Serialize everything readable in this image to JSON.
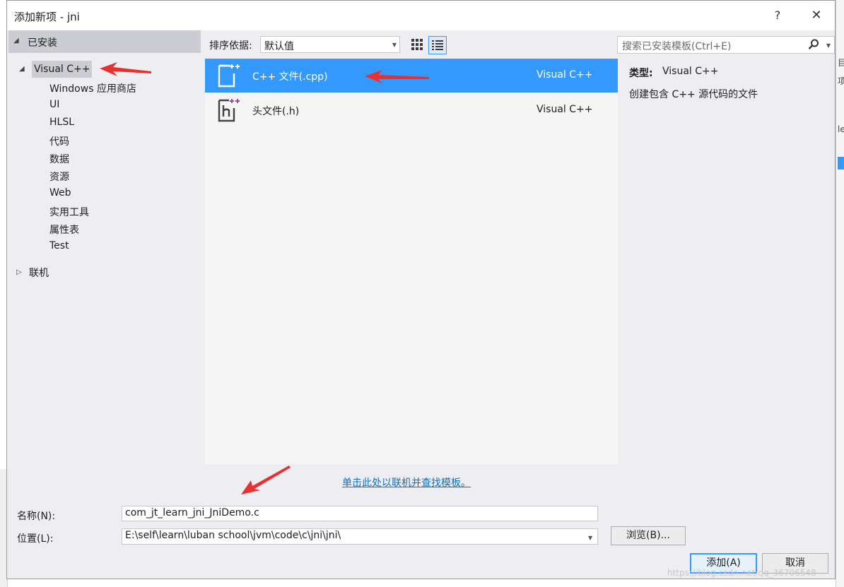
{
  "dialog": {
    "title": "添加新项 - jni",
    "help_glyph": "?",
    "close_glyph": "✕"
  },
  "tree": {
    "installed_label": "已安装",
    "vcpp_label": "Visual C++",
    "children": [
      "Windows 应用商店",
      "UI",
      "HLSL",
      "代码",
      "数据",
      "资源",
      "Web",
      "实用工具",
      "属性表",
      "Test"
    ],
    "online_label": "联机"
  },
  "toolbar": {
    "sort_label": "排序依据:",
    "sort_value": "默认值",
    "search_placeholder": "搜索已安装模板(Ctrl+E)"
  },
  "templates": [
    {
      "name": "C++ 文件(.cpp)",
      "type": "Visual C++",
      "icon": "cpp-file-icon",
      "selected": true
    },
    {
      "name": "头文件(.h)",
      "type": "Visual C++",
      "icon": "header-file-icon",
      "selected": false
    }
  ],
  "details": {
    "type_label": "类型:",
    "type_value": "Visual C++",
    "description": "创建包含 C++ 源代码的文件"
  },
  "online_link": "单击此处以联机并查找模板。",
  "form": {
    "name_label": "名称(N):",
    "name_value": "com_jt_learn_jni_JniDemo.c",
    "location_label": "位置(L):",
    "location_value": "E:\\self\\learn\\luban school\\jvm\\code\\c\\jni\\jni\\",
    "browse_label": "浏览(B)...",
    "add_label": "添加(A)",
    "cancel_label": "取消"
  },
  "watermark": "https://blog.csdn.net/qq_36706548",
  "colors": {
    "accent": "#3399ff",
    "link": "#0e70c0",
    "annotation_arrow": "#e8312f"
  }
}
